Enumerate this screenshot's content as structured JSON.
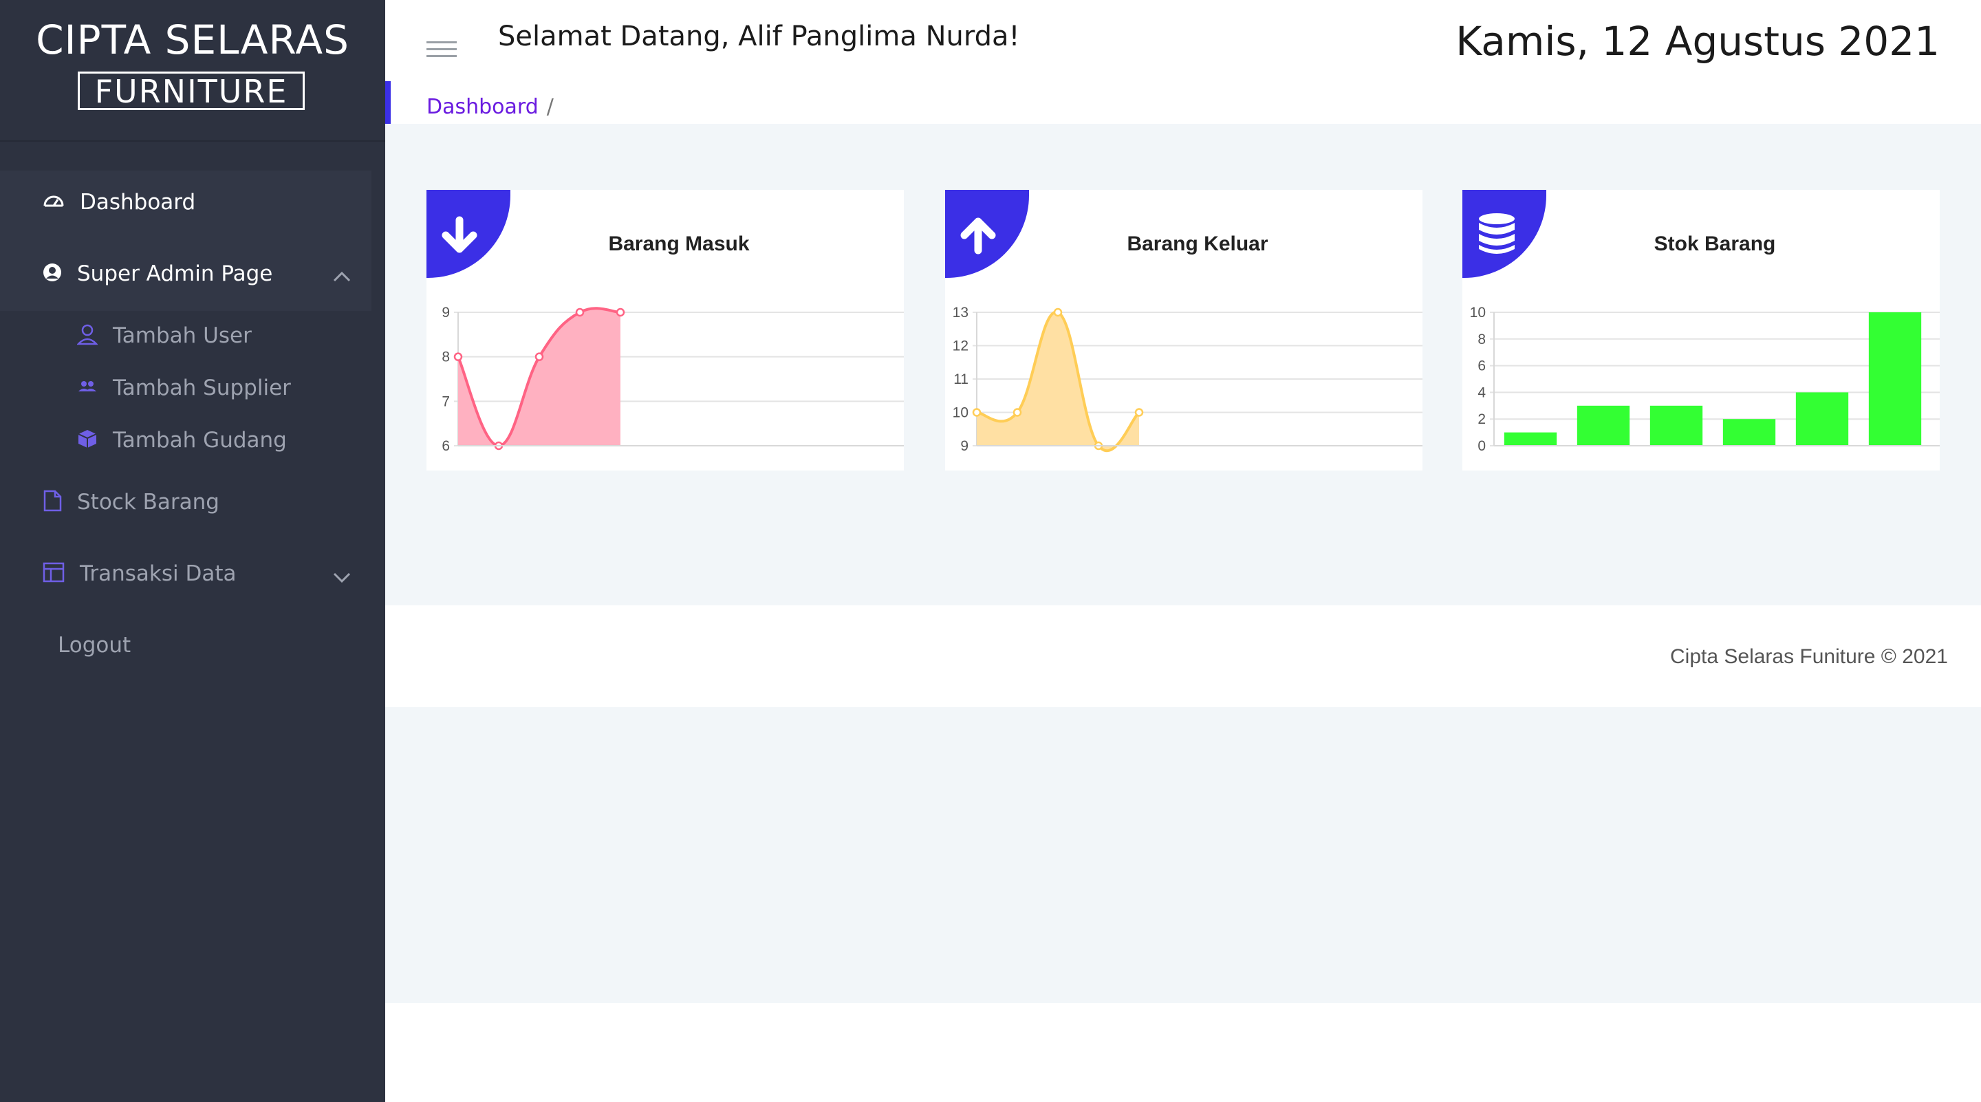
{
  "brand": {
    "line1": "CIPTA SELARAS",
    "line2": "FURNITURE"
  },
  "sidebar": {
    "items": [
      {
        "label": "Dashboard",
        "icon": "dashboard-icon",
        "color": "#ffffff"
      },
      {
        "label": "Super Admin Page",
        "icon": "user-circle-icon",
        "color": "#ffffff",
        "expanded": true
      },
      {
        "label": "Tambah User",
        "icon": "user-outline-icon",
        "color": "#9ea3b0"
      },
      {
        "label": "Tambah Supplier",
        "icon": "users-icon",
        "color": "#9ea3b0"
      },
      {
        "label": "Tambah Gudang",
        "icon": "cube-icon",
        "color": "#9ea3b0"
      },
      {
        "label": "Stock Barang",
        "icon": "file-icon",
        "color": "#9ea3b0"
      },
      {
        "label": "Transaksi Data",
        "icon": "table-icon",
        "color": "#9ea3b0",
        "expanded": false
      },
      {
        "label": "Logout",
        "icon": "",
        "color": "#9ea3b0"
      }
    ]
  },
  "header": {
    "welcome": "Selamat Datang, Alif Panglima Nurda!",
    "date": "Kamis, 12 Agustus 2021"
  },
  "breadcrumb": {
    "current": "Dashboard",
    "separator": "/"
  },
  "cards": [
    {
      "title": "Barang Masuk",
      "icon": "arrow-down-icon",
      "chart_data": {
        "type": "area",
        "x": [
          1,
          2,
          3,
          4,
          5
        ],
        "values": [
          8,
          6,
          8,
          9,
          9
        ],
        "ylim": [
          6,
          9
        ],
        "yticks": [
          6,
          7,
          8,
          9
        ],
        "color": "#ff6384",
        "fill": "#ffb1c1"
      }
    },
    {
      "title": "Barang Keluar",
      "icon": "arrow-up-icon",
      "chart_data": {
        "type": "area",
        "x": [
          1,
          2,
          3,
          4,
          5
        ],
        "values": [
          10,
          10,
          13,
          9,
          10
        ],
        "ylim": [
          9,
          13
        ],
        "yticks": [
          9,
          10,
          11,
          12,
          13
        ],
        "color": "#ffcd56",
        "fill": "#ffe0a3"
      }
    },
    {
      "title": "Stok Barang",
      "icon": "database-icon",
      "chart_data": {
        "type": "bar",
        "values": [
          1,
          3,
          3,
          2,
          4,
          10
        ],
        "ylim": [
          0,
          10
        ],
        "yticks": [
          0,
          2,
          4,
          6,
          8,
          10
        ],
        "color": "#33ff33"
      }
    }
  ],
  "footer": {
    "text": "Cipta Selaras Funiture © 2021"
  },
  "colors": {
    "accent": "#3b2fe6",
    "sidebar": "#2d3240",
    "breadcrumb_link": "#6a1be0"
  }
}
